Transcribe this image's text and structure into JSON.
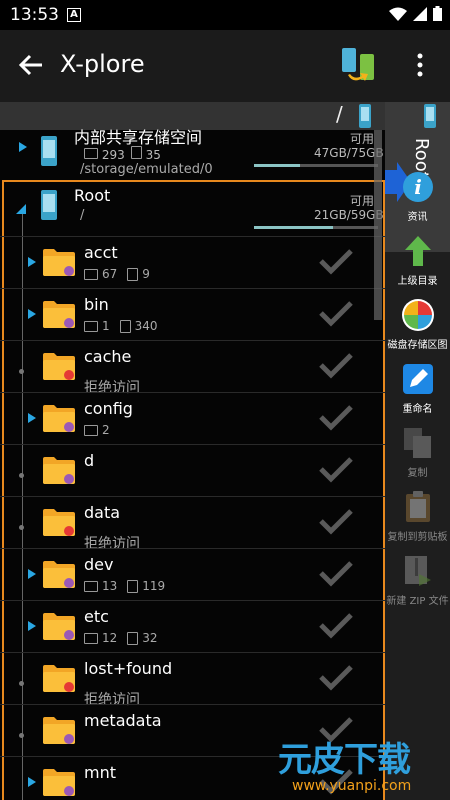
{
  "status_bar": {
    "time": "13:53",
    "notification_icon": "A"
  },
  "app_bar": {
    "title": "X-plore"
  },
  "path_bar": {
    "path": "/"
  },
  "storage_entry": {
    "name": "内部共享存储空间",
    "folders": "293",
    "files": "35",
    "path": "/storage/emulated/0",
    "avail_label": "可用",
    "capacity": "47GB/75GB",
    "used_fraction": 0.37
  },
  "root_entry": {
    "name": "Root",
    "path": "/",
    "avail_label": "可用",
    "capacity": "21GB/59GB",
    "used_fraction": 0.64
  },
  "side_panel": {
    "label": "Root"
  },
  "folders": [
    {
      "name": "acct",
      "folders": "67",
      "files": "9",
      "denied": "",
      "expandable": true,
      "lock": false
    },
    {
      "name": "bin",
      "folders": "1",
      "files": "340",
      "denied": "",
      "expandable": true,
      "lock": false
    },
    {
      "name": "cache",
      "folders": "",
      "files": "",
      "denied": "拒绝访问",
      "expandable": false,
      "lock": true
    },
    {
      "name": "config",
      "folders": "2",
      "files": "",
      "denied": "",
      "expandable": true,
      "lock": false
    },
    {
      "name": "d",
      "folders": "",
      "files": "",
      "denied": "",
      "expandable": false,
      "lock": false
    },
    {
      "name": "data",
      "folders": "",
      "files": "",
      "denied": "拒绝访问",
      "expandable": false,
      "lock": true
    },
    {
      "name": "dev",
      "folders": "13",
      "files": "119",
      "denied": "",
      "expandable": true,
      "lock": false
    },
    {
      "name": "etc",
      "folders": "12",
      "files": "32",
      "denied": "",
      "expandable": true,
      "lock": false
    },
    {
      "name": "lost+found",
      "folders": "",
      "files": "",
      "denied": "拒绝访问",
      "expandable": false,
      "lock": true
    },
    {
      "name": "metadata",
      "folders": "",
      "files": "",
      "denied": "",
      "expandable": false,
      "lock": false
    },
    {
      "name": "mnt",
      "folders": "",
      "files": "",
      "denied": "",
      "expandable": true,
      "lock": false
    }
  ],
  "tools": [
    {
      "label": "资讯",
      "icon": "info-icon",
      "enabled": true
    },
    {
      "label": "上级目录",
      "icon": "up-arrow-icon",
      "enabled": true
    },
    {
      "label": "磁盘存储区图",
      "icon": "disk-map-icon",
      "enabled": true
    },
    {
      "label": "重命名",
      "icon": "rename-icon",
      "enabled": true
    },
    {
      "label": "复制",
      "icon": "copy-icon",
      "enabled": false
    },
    {
      "label": "复制到剪贴板",
      "icon": "clipboard-icon",
      "enabled": false
    },
    {
      "label": "新建 ZIP 文件",
      "icon": "zip-icon",
      "enabled": false
    }
  ],
  "watermark": {
    "text": "元皮下载",
    "url": "www.yuanpi.com"
  },
  "colors": {
    "accent": "#e8891e",
    "arrow": "#2aa7e3",
    "appbar": "#1b1b1b"
  }
}
